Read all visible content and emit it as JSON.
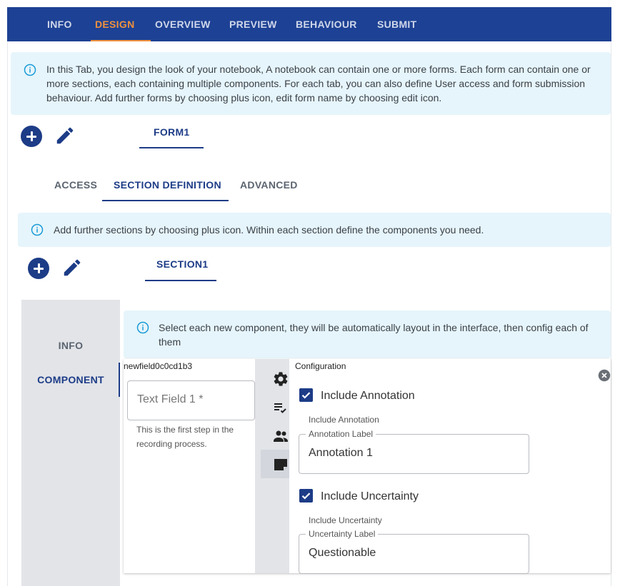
{
  "nav": {
    "tabs": [
      {
        "label": "INFO"
      },
      {
        "label": "DESIGN"
      },
      {
        "label": "OVERVIEW"
      },
      {
        "label": "PREVIEW"
      },
      {
        "label": "BEHAVIOUR"
      },
      {
        "label": "SUBMIT"
      }
    ],
    "active": "DESIGN",
    "active_color": "#f0913e",
    "bar_color": "#1d4194"
  },
  "design_info": "In this Tab, you design the look of your notebook, A notebook can contain one or more forms. Each form can contain one or more sections, each containing multiple components. For each tab, you can also define User access and form submission behaviour. Add further forms by choosing plus icon, edit form name by choosing edit icon.",
  "forms": {
    "tabs": [
      {
        "label": "FORM1"
      }
    ],
    "add_icon": "add-circle-icon",
    "edit_icon": "pencil-icon"
  },
  "form_tabs": [
    {
      "label": "ACCESS"
    },
    {
      "label": "SECTION DEFINITION"
    },
    {
      "label": "ADVANCED"
    }
  ],
  "section_info": "Add further sections by choosing plus icon. Within each section define the components you need.",
  "sections": {
    "tabs": [
      {
        "label": "SECTION1"
      }
    ]
  },
  "side_tabs": [
    {
      "label": "INFO"
    },
    {
      "label": "COMPONENT"
    }
  ],
  "component_info": "Select each new component, they will be automatically layout in the interface, then config each of them",
  "component": {
    "field_id": "newfield0c0cd1b3",
    "placeholder": "Text Field 1 *",
    "helper": "This is the first step in the recording process."
  },
  "rail_icons": [
    "gear-icon",
    "checklist-icon",
    "people-icon",
    "note-icon"
  ],
  "config": {
    "title": "Configuration",
    "annotation": {
      "checkbox_label": "Include Annotation",
      "caption": "Include Annotation",
      "field_label": "Annotation Label",
      "value": "Annotation 1"
    },
    "uncertainty": {
      "checkbox_label": "Include Uncertainty",
      "caption": "Include Uncertainty",
      "field_label": "Uncertainty Label",
      "value": "Questionable"
    }
  }
}
